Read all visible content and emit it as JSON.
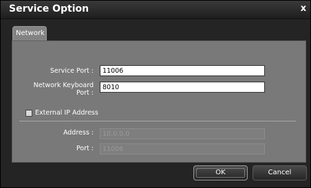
{
  "window": {
    "title": "Service Option",
    "close_glyph": "x"
  },
  "tabs": [
    {
      "label": "Network"
    }
  ],
  "network": {
    "service_port_label": "Service Port :",
    "service_port_value": "11006",
    "keyboard_port_label_line1": "Network Keyboard",
    "keyboard_port_label_line2": "Port :",
    "keyboard_port_value": "8010",
    "external_ip_label": "External IP Address",
    "external_ip_checked": false,
    "address_label": "Address :",
    "address_value": "10.0.0.0",
    "port_label": "Port :",
    "port_value": "11006"
  },
  "buttons": {
    "ok_label": "OK",
    "cancel_label": "Cancel"
  }
}
